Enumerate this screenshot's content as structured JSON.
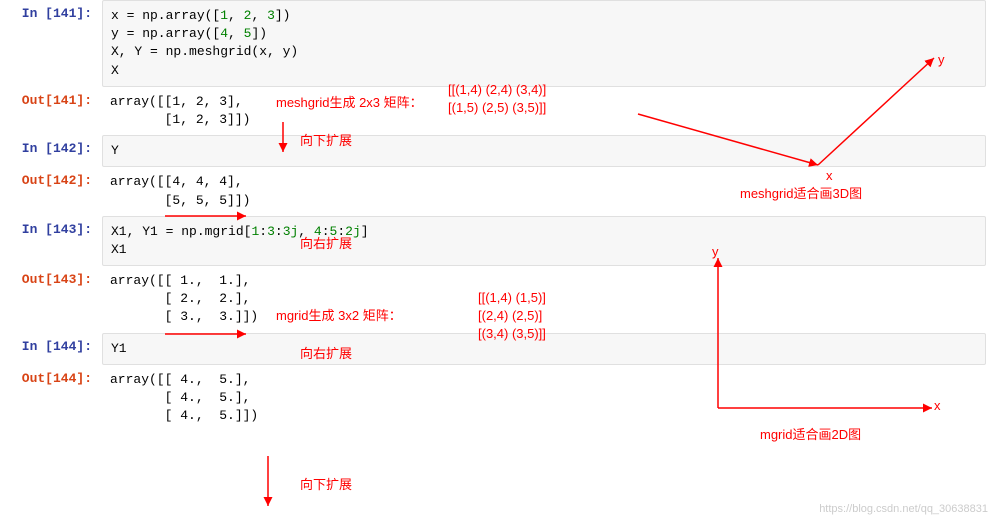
{
  "cells": [
    {
      "in_prompt": "In [141]:",
      "code_lines": [
        [
          {
            "t": "x = np.array(["
          },
          {
            "t": "1",
            "c": "num"
          },
          {
            "t": ", "
          },
          {
            "t": "2",
            "c": "num"
          },
          {
            "t": ", "
          },
          {
            "t": "3",
            "c": "num"
          },
          {
            "t": "])"
          }
        ],
        [
          {
            "t": "y = np.array(["
          },
          {
            "t": "4",
            "c": "num"
          },
          {
            "t": ", "
          },
          {
            "t": "5",
            "c": "num"
          },
          {
            "t": "])"
          }
        ],
        [
          {
            "t": "X, Y = np.meshgrid(x, y)"
          }
        ],
        [
          {
            "t": "X"
          }
        ]
      ],
      "out_prompt": "Out[141]:",
      "out_lines": [
        "array([[1, 2, 3],",
        "       [1, 2, 3]])"
      ]
    },
    {
      "in_prompt": "In [142]:",
      "code_lines": [
        [
          {
            "t": "Y"
          }
        ]
      ],
      "out_prompt": "Out[142]:",
      "out_lines": [
        "array([[4, 4, 4],",
        "       [5, 5, 5]])"
      ]
    },
    {
      "in_prompt": "In [143]:",
      "code_lines": [
        [
          {
            "t": "X1, Y1 = np.mgrid["
          },
          {
            "t": "1",
            "c": "num"
          },
          {
            "t": ":"
          },
          {
            "t": "3",
            "c": "num"
          },
          {
            "t": ":"
          },
          {
            "t": "3j",
            "c": "complex"
          },
          {
            "t": ", "
          },
          {
            "t": "4",
            "c": "num"
          },
          {
            "t": ":"
          },
          {
            "t": "5",
            "c": "num"
          },
          {
            "t": ":"
          },
          {
            "t": "2j",
            "c": "complex"
          },
          {
            "t": "]"
          }
        ],
        [
          {
            "t": "X1"
          }
        ]
      ],
      "out_prompt": "Out[143]:",
      "out_lines": [
        "array([[ 1.,  1.],",
        "       [ 2.,  2.],",
        "       [ 3.,  3.]])"
      ]
    },
    {
      "in_prompt": "In [144]:",
      "code_lines": [
        [
          {
            "t": "Y1"
          }
        ]
      ],
      "out_prompt": "Out[144]:",
      "out_lines": [
        "array([[ 4.,  5.],",
        "       [ 4.,  5.],",
        "       [ 4.,  5.]])"
      ]
    }
  ],
  "annotations": {
    "meshgrid_gen": "meshgrid生成 2x3 矩阵：",
    "down_expand": "向下扩展",
    "right_expand": "向右扩展",
    "mgrid_gen": "mgrid生成 3x2 矩阵：",
    "meshgrid_3d": "meshgrid适合画3D图",
    "mgrid_2d": "mgrid适合画2D图",
    "matrix_2x3_l1": "[[(1,4) (2,4) (3,4)]",
    "matrix_2x3_l2": " [(1,5) (2,5) (3,5)]]",
    "matrix_3x2_l1": "[[(1,4) (1,5)]",
    "matrix_3x2_l2": " [(2,4) (2,5)]",
    "matrix_3x2_l3": " [(3,4) (3,5)]]",
    "x_label": "x",
    "y_label": "y"
  },
  "watermark": "https://blog.csdn.net/qq_30638831"
}
